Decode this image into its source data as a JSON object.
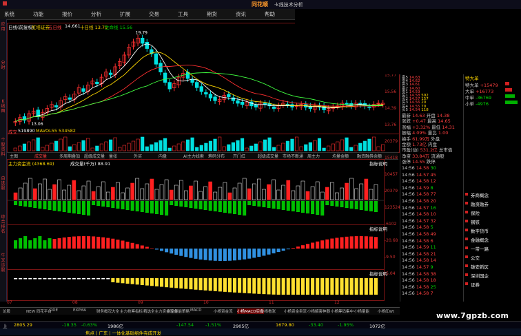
{
  "title": {
    "brand": "同花顺",
    "app": "-k线技术分析"
  },
  "menu": [
    "系统",
    "功能",
    "报价",
    "分析",
    "扩展",
    "交易",
    "工具",
    "期货",
    "资讯",
    "帮助"
  ],
  "header": {
    "stock": "日线(前复权)",
    "name": "红塔证券",
    "ma_label": "五日线",
    "price1": "14.661",
    "ma10": "十日线 13.79",
    "ma20": "生命线 15.56"
  },
  "left_tabs": [
    "应用",
    "分时",
    "K线图",
    "个股资料",
    "自选股",
    "综合排名",
    "牛叉诊股"
  ],
  "price_axis": [
    "15.77",
    "15.56",
    "14.39",
    "13.76"
  ],
  "price_marks": {
    "high": "19.79",
    "low": "13.06"
  },
  "volume": {
    "label": "成交",
    "v1": "519890",
    "v2": "MAVOL55 534582"
  },
  "vol_axis": [
    "20379",
    "15418",
    "10457"
  ],
  "tool_tabs": [
    "主图",
    "成交量",
    "多周期叠加",
    "超级成交量",
    "量张",
    "外买",
    "内盘",
    "AI主力线索",
    "筹码分布",
    "开门红",
    "超级成交量",
    "市场不断涌",
    "周主力",
    "均量金额",
    "融资融券余额"
  ],
  "sub1": {
    "label": "主力资金流 (4368.69)",
    "extra": "成交量(千万) 88.91",
    "title": "指标说明"
  },
  "sub2": {
    "title": "指标说明"
  },
  "sub3": {
    "title": "指标说明"
  },
  "sub_axis": [
    "20379",
    "123524",
    "-6102",
    "-20.68",
    "-9.50",
    "-5.04"
  ],
  "x_axis": [
    "07",
    "08",
    "09",
    "10",
    "11",
    "12"
  ],
  "bottom_tabs": [
    "论股",
    "NEW 同花平台",
    "DDE",
    "EXPMA",
    "财务概况大全",
    "主力抢筹指标",
    "精选全主力资金流向",
    "多空量能策略",
    "MACD",
    "小杨资金流",
    "小杨MACD实盘",
    "小杨看涨",
    "小杨资金卖流",
    "小杨解套神器",
    "小杨筹码集中",
    "小杨量能",
    "小杨红Wt"
  ],
  "quote": {
    "head": [
      "卖",
      "买"
    ],
    "sell": [
      [
        "卖5",
        "14.63",
        ""
      ],
      [
        "卖4",
        "14.62",
        ""
      ],
      [
        "卖3",
        "14.61",
        ""
      ],
      [
        "卖2",
        "14.60",
        ""
      ],
      [
        "卖1",
        "14.59",
        ""
      ]
    ],
    "buy": [
      [
        "买1",
        "14.58",
        "592"
      ],
      [
        "买2",
        "14.57",
        "157"
      ],
      [
        "买3",
        "14.56",
        "20"
      ],
      [
        "买4",
        "14.55",
        "70"
      ],
      [
        "买5",
        "14.54",
        "118"
      ]
    ],
    "stats": [
      [
        "最新",
        "14.63",
        "开盘",
        "14.38"
      ],
      [
        "涨跌",
        "+0.47",
        "最高",
        "14.65"
      ],
      [
        "涨幅",
        "+3.32%",
        "最低",
        "14.31"
      ],
      [
        "振幅",
        "4.09%",
        "量比",
        "1.00"
      ],
      [
        "换手",
        "61.99万",
        "外盘",
        ""
      ],
      [
        "金额",
        "1.73亿",
        "内盘",
        ""
      ],
      [
        "市盈(动)",
        "531.2亿",
        "总市值",
        ""
      ],
      [
        "净资",
        "33.84万",
        "流通股",
        ""
      ],
      [
        "涨停",
        "14.55",
        "跌停",
        ""
      ]
    ],
    "ticks": [
      [
        "14:56",
        "14.58",
        "30"
      ],
      [
        "14:56",
        "14.57",
        "45"
      ],
      [
        "14:56",
        "14.58",
        "12"
      ],
      [
        "14:56",
        "14.59",
        "8"
      ],
      [
        "14:56",
        "14.58",
        "77"
      ],
      [
        "14:56",
        "14.58",
        "20"
      ],
      [
        "14:56",
        "14.57",
        "16"
      ],
      [
        "14:56",
        "14.58",
        "10"
      ],
      [
        "14:56",
        "14.57",
        "32"
      ],
      [
        "14:56",
        "14.58",
        "5"
      ],
      [
        "14:56",
        "14.58",
        "49"
      ],
      [
        "14:56",
        "14.58",
        "6"
      ],
      [
        "14:56",
        "14.59",
        "11"
      ],
      [
        "14:56",
        "14.58",
        "21"
      ],
      [
        "14:56",
        "14.58",
        "14"
      ],
      [
        "14:56",
        "14.57",
        "9"
      ],
      [
        "14:56",
        "14.58",
        "38"
      ],
      [
        "14:56",
        "14.58",
        "18"
      ],
      [
        "14:56",
        "14.58",
        "25"
      ],
      [
        "14:56",
        "14.58",
        "7"
      ]
    ],
    "flows": [
      "大单买入",
      "大单卖出",
      "大单买入",
      "大单买入"
    ]
  },
  "rp": {
    "title": "特大单",
    "rows": [
      "特大单",
      "大单",
      "中单",
      "小单"
    ],
    "vals": [
      "+15479",
      "+16773",
      "-36769",
      "-4976"
    ],
    "sectors": [
      "券商概念",
      "融资融券",
      "保险",
      "钢铁",
      "数字货币",
      "金融概念",
      "一带一路",
      "公交",
      "雄安新区",
      "深圳国企",
      "证券"
    ]
  },
  "status": {
    "sh": "2805.29",
    "shchg": "-18.35",
    "pct": "-0.63%",
    "amt": "1986亿",
    "cy": "-147.54",
    "cypct": "-1.51%",
    "v2": "2905亿",
    "v3": "1679.80",
    "v4": "-33.40",
    "v5": "-1.95%",
    "v6": "1072亿"
  },
  "info": {
    "text": "焦点 | 广东 | 一体化基础组件完成开发",
    "wm": "www.7gpzb.com"
  },
  "colors": {
    "up": "#ff3030",
    "down": "#00e0e0",
    "ma5": "#ffffff",
    "ma20": "#40ff40"
  }
}
